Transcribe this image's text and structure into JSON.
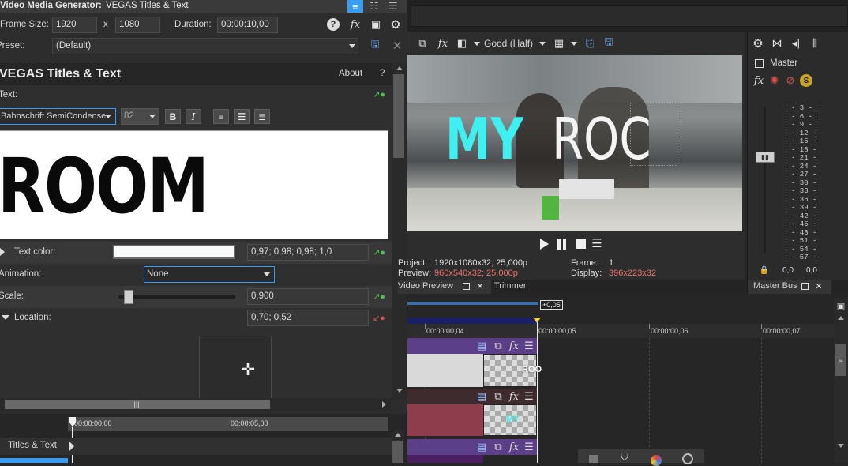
{
  "window": {
    "title": "Video Media Generator:",
    "subtitle": "VEGAS Titles & Text"
  },
  "frame": {
    "size_label": "Frame Size:",
    "width": "1920",
    "x_sep": "x",
    "height": "1080",
    "duration_label": "Duration:",
    "duration": "00:00:10,00"
  },
  "preset": {
    "label": "Preset:",
    "value": "(Default)"
  },
  "plugin": {
    "title": "VEGAS Titles & Text",
    "about": "About",
    "help": "?"
  },
  "text_section": {
    "label": "Text:",
    "font": "Bahnschrift SemiCondense",
    "size": "82",
    "bold": "B",
    "italic": "I",
    "content": "ROOM"
  },
  "props": {
    "text_color_label": "Text color:",
    "text_color_value": "0,97; 0,98; 0,98; 1,0",
    "animation_label": "Animation:",
    "animation_value": "None",
    "scale_label": "Scale:",
    "scale_value": "0,900",
    "scale_fraction": 0.05,
    "location_label": "Location:",
    "location_value": "0,70; 0,52"
  },
  "keyframes": {
    "start": "00:00:00,00",
    "mid": "00:00:05,00",
    "track_label": "Titles & Text"
  },
  "preview": {
    "quality": "Good (Half)",
    "overlay_a": "MY",
    "overlay_b": "ROC",
    "project_label": "Project:",
    "project_value": "1920x1080x32; 25,000p",
    "preview_label": "Preview:",
    "preview_value": "960x540x32; 25,000p",
    "frame_label": "Frame:",
    "frame_value": "1",
    "display_label": "Display:",
    "display_value": "396x223x32",
    "tab_preview": "Video Preview",
    "tab_trimmer": "Trimmer"
  },
  "master": {
    "label": "Master",
    "bus_tab": "Master Bus",
    "db_left": "0,0",
    "db_right": "0,0",
    "scale": [
      "3",
      "6",
      "9",
      "12",
      "15",
      "18",
      "21",
      "24",
      "27",
      "30",
      "33",
      "36",
      "39",
      "42",
      "45",
      "48",
      "51",
      "54",
      "57"
    ]
  },
  "timeline": {
    "offset": "+0,05",
    "t4": "00:00:00,04",
    "t5": "00:00:00,05",
    "t6": "00:00:00,06",
    "t7": "00:00:00,07",
    "clip1_text": "ROO",
    "clip2_text": "MY"
  },
  "colors": {
    "accent": "#3a9cf0",
    "cyan": "#3ef0f0",
    "track_purple": "#5b3f88",
    "clip_red": "#8e3d4d"
  }
}
